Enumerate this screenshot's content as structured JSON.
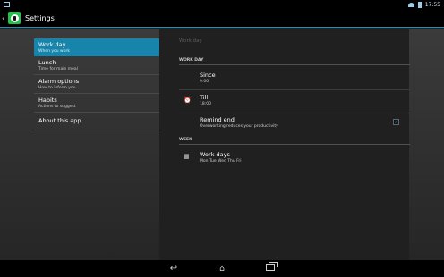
{
  "status_bar": {
    "time": "17:55"
  },
  "action_bar": {
    "title": "Settings"
  },
  "headers": [
    {
      "title": "Work day",
      "summary": "When you work"
    },
    {
      "title": "Lunch",
      "summary": "Time for main meal"
    },
    {
      "title": "Alarm options",
      "summary": "How to inform you"
    },
    {
      "title": "Habits",
      "summary": "Actions to suggest"
    },
    {
      "title": "About this app",
      "summary": ""
    }
  ],
  "detail": {
    "breadcrumb": "Work day",
    "sections": [
      {
        "label": "WORK DAY"
      },
      {
        "label": "WEEK"
      }
    ],
    "prefs": [
      {
        "title": "Since",
        "summary": "9:00",
        "icon": "none"
      },
      {
        "title": "Till",
        "summary": "18:00",
        "icon": "alarm-icon"
      },
      {
        "title": "Remind end",
        "summary": "Overworking reduces your productivity",
        "checked": true
      },
      {
        "title": "Work days",
        "summary": "Mon Tue Wed Thu Fri",
        "icon": "calendar-icon"
      }
    ]
  },
  "colors": {
    "accent": "#1784ab",
    "app_icon_green": "#25c24a",
    "check_blue": "#2aa8e0"
  }
}
